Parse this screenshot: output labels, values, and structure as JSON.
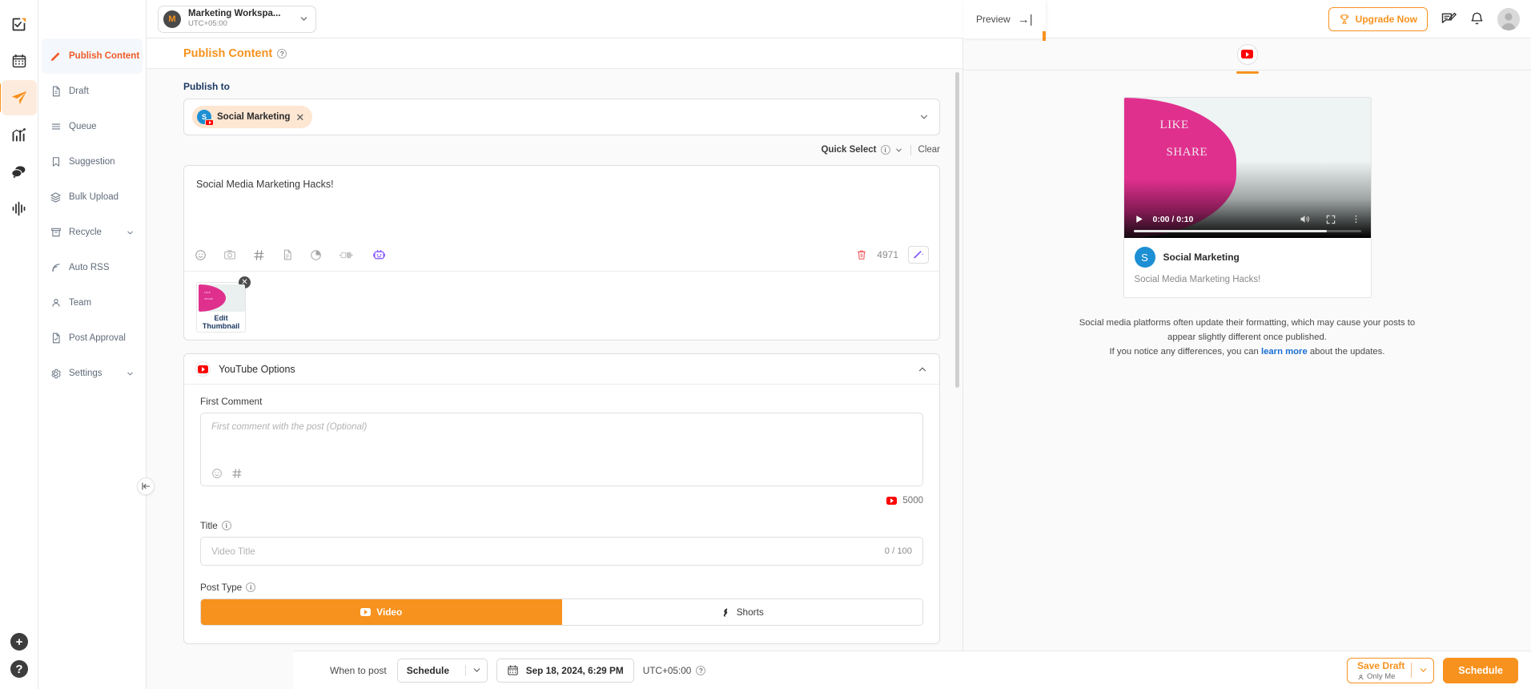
{
  "header": {
    "workspace_name": "Marketing Workspa...",
    "workspace_initial": "M",
    "timezone": "UTC+05:00",
    "upgrade_label": "Upgrade Now",
    "icons": [
      "trophy-icon",
      "feedback-icon",
      "bell-icon",
      "user-avatar"
    ]
  },
  "rail": {
    "items": [
      {
        "name": "brand-logo-icon"
      },
      {
        "name": "calendar-icon"
      },
      {
        "name": "publish-icon"
      },
      {
        "name": "analytics-icon"
      },
      {
        "name": "inbox-icon"
      },
      {
        "name": "insights-icon"
      }
    ],
    "bottom": [
      {
        "name": "add-icon",
        "glyph": "+"
      },
      {
        "name": "help-icon",
        "glyph": "?"
      }
    ]
  },
  "sidebar": {
    "items": [
      {
        "label": "Publish Content",
        "icon": "pencil-icon",
        "active": true
      },
      {
        "label": "Draft",
        "icon": "document-icon",
        "active": false
      },
      {
        "label": "Queue",
        "icon": "list-icon",
        "active": false
      },
      {
        "label": "Suggestion",
        "icon": "bookmark-icon",
        "active": false
      },
      {
        "label": "Bulk Upload",
        "icon": "layers-icon",
        "active": false
      },
      {
        "label": "Recycle",
        "icon": "archive-icon",
        "active": false,
        "chevron": true
      },
      {
        "label": "Auto RSS",
        "icon": "rss-icon",
        "active": false
      },
      {
        "label": "Team",
        "icon": "person-icon",
        "active": false
      },
      {
        "label": "Post Approval",
        "icon": "approval-icon",
        "active": false
      },
      {
        "label": "Settings",
        "icon": "gear-icon",
        "active": false,
        "chevron": true
      }
    ]
  },
  "editor": {
    "page_title": "Publish Content",
    "publish_to_label": "Publish to",
    "account_chip": {
      "name": "Social Marketing",
      "initial": "S",
      "platform": "youtube"
    },
    "quick_select_label": "Quick Select",
    "clear_label": "Clear",
    "composer_text": "Social Media Marketing Hacks!",
    "char_count": "4971",
    "toolbar_icons": [
      "emoji-icon",
      "camera-icon",
      "hashtag-icon",
      "document-icon",
      "pie-clock-icon",
      "plug-icon",
      "ai-robot-icon"
    ],
    "thumbnail": {
      "caption": "Edit Thumbnail",
      "overlay_line1": "LIKE",
      "overlay_line2": "SHARE"
    }
  },
  "youtube_options": {
    "panel_title": "YouTube Options",
    "first_comment_label": "First Comment",
    "first_comment_placeholder": "First comment with the post (Optional)",
    "first_comment_count": "5000",
    "title_label": "Title",
    "title_placeholder": "Video Title",
    "title_count": "0 / 100",
    "post_type_label": "Post Type",
    "post_types": [
      {
        "label": "Video",
        "selected": true
      },
      {
        "label": "Shorts",
        "selected": false
      }
    ]
  },
  "preview": {
    "collapse_label": "Preview",
    "collapse_glyph": "→|",
    "active_tab": "youtube",
    "video": {
      "time": "0:00 / 0:10",
      "overlay_line1": "LIKE",
      "overlay_line2": "SHARE"
    },
    "account_name": "Social Marketing",
    "account_initial": "S",
    "post_text": "Social Media Marketing Hacks!",
    "note_line1": "Social media platforms often update their formatting, which may cause your posts",
    "note_line2": "to appear slightly different once published.",
    "note_line3_pre": "If you notice any differences, you can ",
    "note_link": "learn more",
    "note_line3_post": " about the updates."
  },
  "bottombar": {
    "when_label": "When to post",
    "schedule_mode": "Schedule",
    "datetime": "Sep 18, 2024, 6:29 PM",
    "timezone": "UTC+05:00",
    "save_draft_label": "Save Draft",
    "save_draft_sub": "Only Me",
    "schedule_label": "Schedule"
  },
  "colors": {
    "accent": "#f7921e",
    "accent_alt": "#f05a28",
    "youtube_red": "#ff0000",
    "link_blue": "#1a6fd4",
    "pink": "#e0308e"
  }
}
